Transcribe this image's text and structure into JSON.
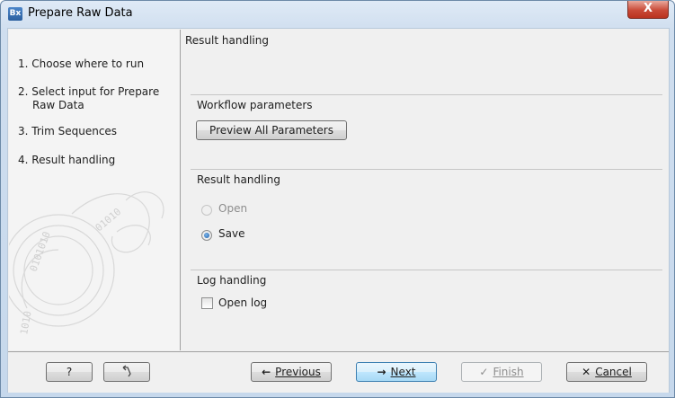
{
  "window": {
    "title": "Prepare Raw Data",
    "app_icon_text": "Bx",
    "close_glyph": "X"
  },
  "sidebar": {
    "steps": [
      {
        "number": "1.",
        "label": "Choose where to run"
      },
      {
        "number": "2.",
        "label": "Select input for Prepare",
        "label_line2": "Raw Data"
      },
      {
        "number": "3.",
        "label": "Trim Sequences"
      },
      {
        "number": "4.",
        "label": "Result handling"
      }
    ]
  },
  "panel": {
    "heading": "Result handling",
    "workflow_group": {
      "title": "Workflow parameters",
      "preview_button": "Preview All Parameters"
    },
    "result_group": {
      "title": "Result handling",
      "options": [
        {
          "label": "Open",
          "selected": false,
          "enabled": false
        },
        {
          "label": "Save",
          "selected": true,
          "enabled": true
        }
      ]
    },
    "log_group": {
      "title": "Log handling",
      "open_log_label": "Open log",
      "open_log_checked": false
    }
  },
  "footer": {
    "help_label": "?",
    "reset_icon": "undo-arrow-icon",
    "previous": {
      "glyph": "←",
      "label": "Previous"
    },
    "next": {
      "glyph": "→",
      "label": "Next"
    },
    "finish": {
      "glyph": "✓",
      "label": "Finish"
    },
    "cancel": {
      "glyph": "✕",
      "label": "Cancel"
    }
  },
  "colors": {
    "accent": "#3c7fb1",
    "titlebar": "#cfdeef",
    "close": "#c94a38"
  }
}
